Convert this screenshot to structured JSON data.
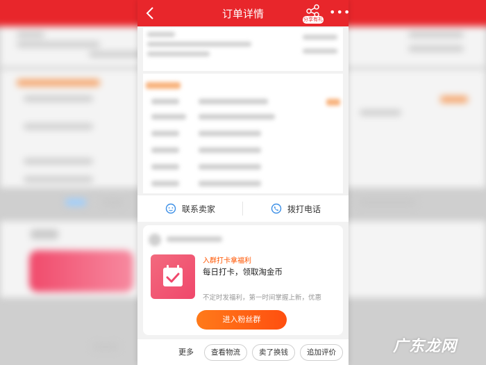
{
  "nav": {
    "title": "订单详情",
    "share_badge": "分享有礼",
    "more": "•••"
  },
  "contact": {
    "seller_label": "联系卖家",
    "phone_label": "拨打电话"
  },
  "promo": {
    "tag": "入群打卡拿福利",
    "title": "每日打卡，领取淘金币",
    "subtitle": "不定时发福利，第一时间掌握上新，优惠",
    "button": "进入粉丝群"
  },
  "bottom": {
    "more": "更多",
    "logistics": "查看物流",
    "sold": "卖了换钱",
    "review": "追加评价"
  },
  "watermark": "广东龙网",
  "colors": {
    "brand_red": "#e8262b",
    "accent_orange": "#ff5500"
  }
}
